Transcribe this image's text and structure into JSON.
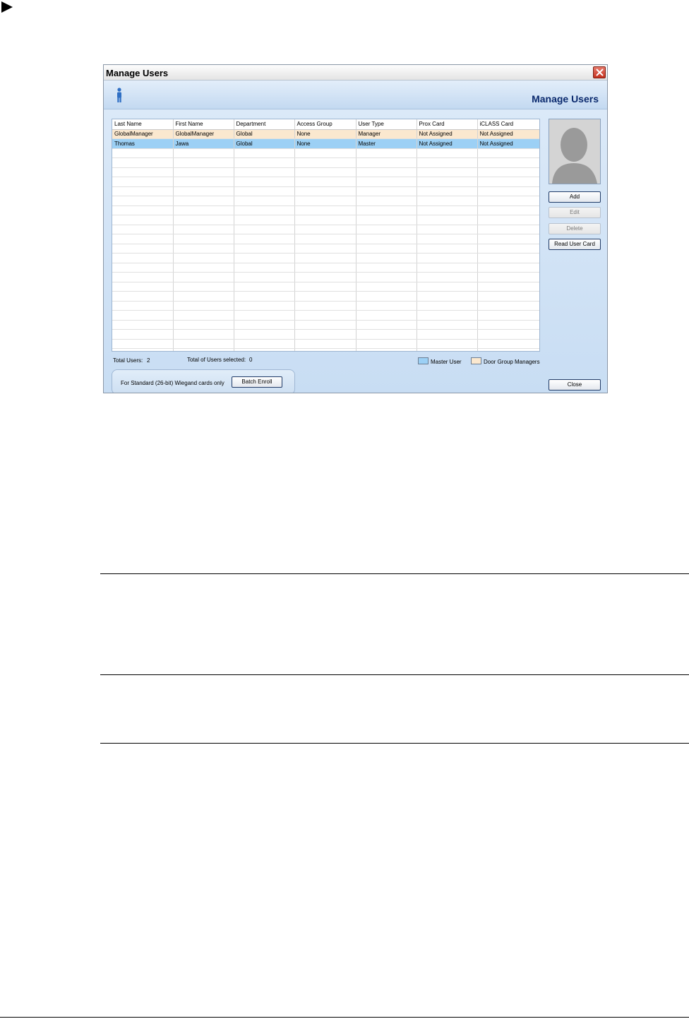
{
  "window": {
    "title": "Manage Users",
    "header_title": "Manage Users"
  },
  "table": {
    "columns": [
      "Last Name",
      "First Name",
      "Department",
      "Access Group",
      "User Type",
      "Prox Card",
      "iCLASS Card"
    ],
    "rows": [
      [
        "GlobalManager",
        "GlobalManager",
        "Global",
        "None",
        "Manager",
        "Not Assigned",
        "Not Assigned"
      ],
      [
        "Thomas",
        "Jawa",
        "Global",
        "None",
        "Master",
        "Not Assigned",
        "Not Assigned"
      ]
    ]
  },
  "buttons": {
    "add": "Add",
    "edit": "Edit",
    "delete": "Delete",
    "read_user_card": "Read User Card",
    "batch_enroll": "Batch Enroll",
    "close": "Close"
  },
  "status": {
    "total_users_label": "Total Users:",
    "total_users_value": "2",
    "selected_label": "Total of Users selected:",
    "selected_value": "0"
  },
  "legend": {
    "master_user": "Master User",
    "door_group_managers": "Door Group Managers",
    "master_color": "#9cd0f5",
    "manager_color": "#fbe8cf"
  },
  "batch": {
    "note": "For Standard (26-bit) Wiegand cards only"
  }
}
